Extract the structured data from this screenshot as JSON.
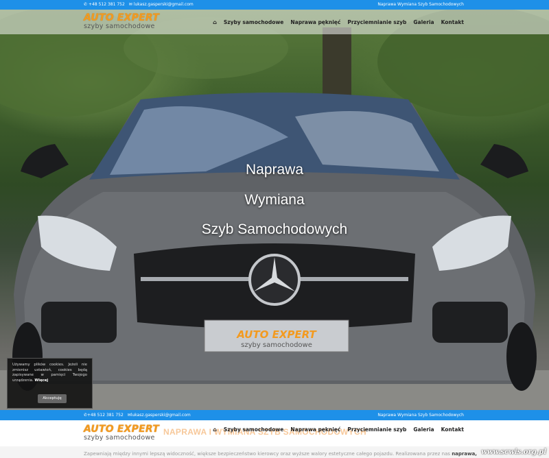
{
  "top_bar": {
    "phone": "+48 512 381 752",
    "email": "lukasz.gasperski@gmail.com",
    "tagline": "Naprawa Wymiana Szyb Samochodowych",
    "phone_icon": "phone-icon",
    "email_icon": "envelope-icon"
  },
  "logo": {
    "line1": "AUTO EXPERT",
    "line2": "szyby samochodowe"
  },
  "nav": {
    "home_icon": "home-icon",
    "items": [
      "Szyby samochodowe",
      "Naprawa pęknięć",
      "Przyciemnianie szyb",
      "Galeria",
      "Kontakt"
    ]
  },
  "hero": {
    "line1": "Naprawa",
    "line2": "Wymiana",
    "line3": "Szyb Samochodowych",
    "plate_line1": "AUTO EXPERT",
    "plate_line2": "szyby samochodowe"
  },
  "cookie": {
    "text": "Używamy plików cookies. Jeżeli nie zmienisz ustawień, cookies będą zapisywane w pamięci Twojego urządzenia.",
    "more": "Więcej",
    "accept": "Akceptuję"
  },
  "section": {
    "ghost_heading": "NAPRAWA I WYMIANA SZYB SAMOCHODOWYCH",
    "intro_text": "Zapewniają między innymi lepszą widoczność, większe bezpieczeństwo kierowcy oraz wyższe walory estetyczne całego pojazdu. Realizowana przez nas",
    "intro_bold": "naprawa,"
  },
  "watermark": "www.scwis.org.pl",
  "colors": {
    "accent_blue": "#1e90e8",
    "logo_orange": "#f39a1f"
  }
}
